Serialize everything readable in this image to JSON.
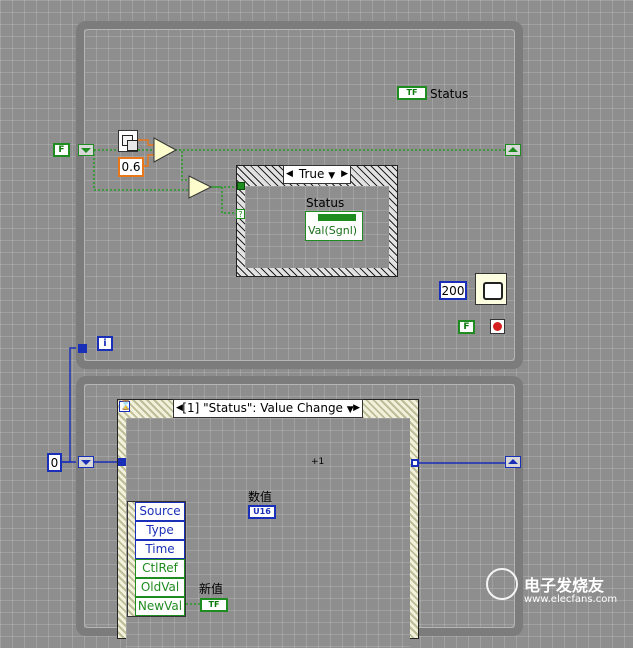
{
  "top_loop": {
    "status_indicator": {
      "terminal": "TF",
      "label": "Status"
    },
    "false_constant": "F",
    "random_compare_constant": "0.6",
    "case_selector_value": "True",
    "property_node": {
      "label": "Status",
      "property": "Val(Sgnl)"
    },
    "wait_ms_constant": "200",
    "stop_constant": "F"
  },
  "bottom_loop": {
    "iteration_terminal": "i",
    "initial_value": "0",
    "event_case_selector": "[1] \"Status\": Value Change",
    "increment_label": "+1",
    "output_label": "数值",
    "output_terminal": "U16",
    "event_data_items": [
      "Source",
      "Type",
      "Time",
      "CtlRef",
      "OldVal",
      "NewVal"
    ],
    "new_value_label": "新值",
    "new_value_terminal": "TF"
  },
  "watermark": {
    "title": "电子发烧友",
    "url": "www.elecfans.com"
  }
}
